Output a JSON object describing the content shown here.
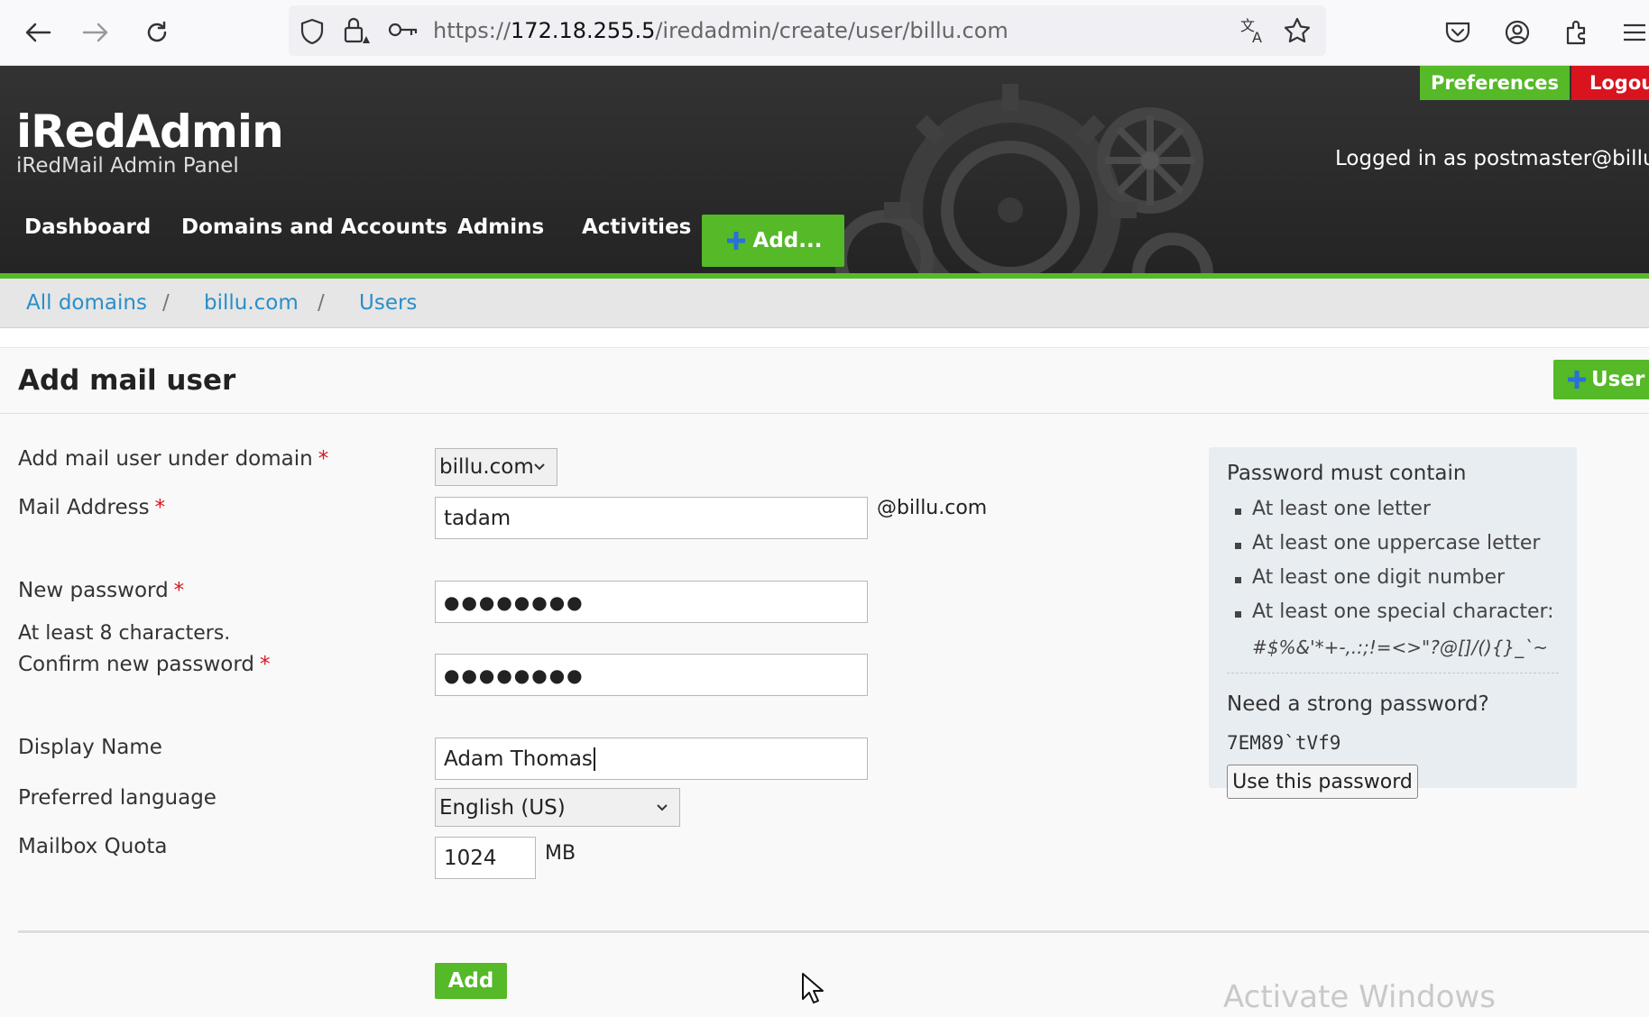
{
  "browser": {
    "url_prefix": "https://",
    "url_host": "172.18.255.5",
    "url_path": "/iredadmin/create/user/billu.com"
  },
  "header": {
    "app_title": "iRedAdmin",
    "app_subtitle": "iRedMail Admin Panel",
    "preferences_label": "Preferences",
    "logout_label": "Logou",
    "logged_in_text": "Logged in as postmaster@billu.c"
  },
  "nav": {
    "items": [
      "Dashboard",
      "Domains and Accounts",
      "Admins",
      "Activities"
    ],
    "add_label": "Add..."
  },
  "breadcrumb": {
    "items": [
      "All domains",
      "billu.com",
      "Users"
    ],
    "separator": "/"
  },
  "page": {
    "title": "Add mail user",
    "user_button": "User"
  },
  "form": {
    "domain_label": "Add mail user under domain",
    "domain_value": "billu.com",
    "mail_label": "Mail Address",
    "mail_value": "tadam",
    "mail_suffix": "@billu.com",
    "password_label": "New password",
    "password_value": "●●●●●●●●",
    "password_hint": "At least 8 characters.",
    "confirm_label": "Confirm new password",
    "confirm_value": "●●●●●●●●",
    "display_label": "Display Name",
    "display_value": "Adam Thomas",
    "language_label": "Preferred language",
    "language_value": "English (US)",
    "quota_label": "Mailbox Quota",
    "quota_value": "1024",
    "quota_unit": "MB",
    "required_mark": "*",
    "submit_label": "Add"
  },
  "sidebar": {
    "title": "Password must contain",
    "rules": [
      "At least one letter",
      "At least one uppercase letter",
      "At least one digit number",
      "At least one special character:"
    ],
    "special_chars": "#$%&'*+-,.:;!=<>\"?@[]/(){}_`~",
    "strong_title": "Need a strong password?",
    "suggested_password": "7EM89`tVf9",
    "use_button": "Use this password"
  },
  "watermark": "Activate Windows",
  "colors": {
    "accent_green": "#55b928",
    "logout_red": "#d9141e",
    "link_blue": "#2a8ec7",
    "header_dark": "#2a2a2a"
  }
}
